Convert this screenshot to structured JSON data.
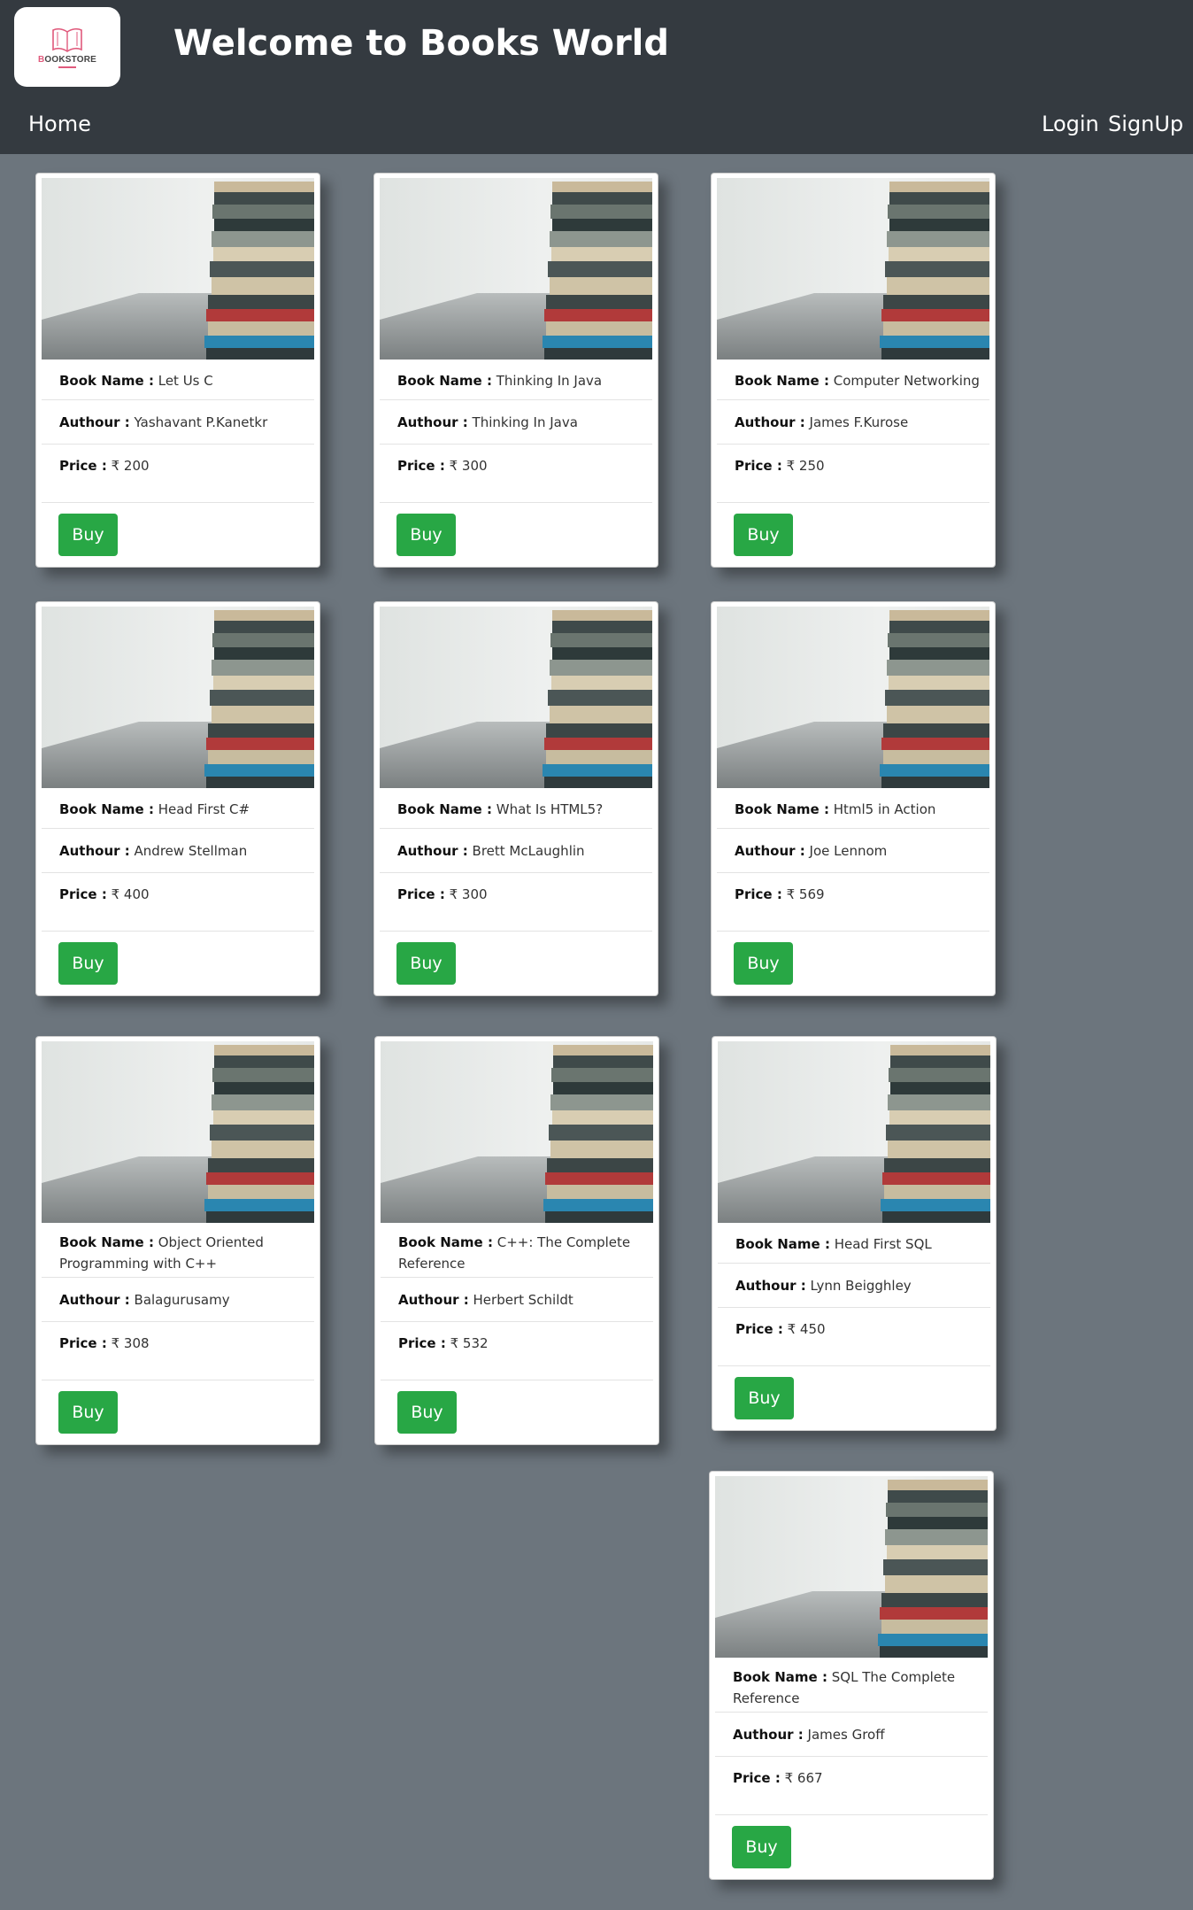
{
  "header": {
    "logo_text_a": "B",
    "logo_text_b": "OOK",
    "logo_text_c": "STORE",
    "title": "Welcome to Books World"
  },
  "nav": {
    "home": "Home",
    "login": "Login",
    "signup": "SignUp"
  },
  "labels": {
    "book_name": "Book Name :",
    "author": "Authour :",
    "price": "Price :",
    "buy": "Buy"
  },
  "currency_symbol": "₹",
  "colors": {
    "header_bg": "#343a40",
    "page_bg": "#6c757d",
    "buy_button": "#28a745",
    "logo_accent": "#e05a7c"
  },
  "books": [
    {
      "name": "Let Us C",
      "author": "Yashavant P.Kanetkr",
      "price": "200"
    },
    {
      "name": "Thinking In Java",
      "author": "Thinking In Java",
      "price": "300"
    },
    {
      "name": "Computer Networking",
      "author": "James F.Kurose",
      "price": "250"
    },
    {
      "name": "Head First C#",
      "author": "Andrew Stellman",
      "price": "400"
    },
    {
      "name": "What Is HTML5?",
      "author": "Brett McLaughlin",
      "price": "300"
    },
    {
      "name": "Html5 in Action",
      "author": "Joe Lennom",
      "price": "569"
    },
    {
      "name": "Object Oriented Programming with C++",
      "author": "Balagurusamy",
      "price": "308"
    },
    {
      "name": "C++: The Complete Reference",
      "author": "Herbert Schildt",
      "price": "532"
    },
    {
      "name": "Head First SQL",
      "author": "Lynn Beigghley",
      "price": "450"
    },
    {
      "name": "SQL The Complete Reference",
      "author": "James Groff",
      "price": "667"
    }
  ]
}
